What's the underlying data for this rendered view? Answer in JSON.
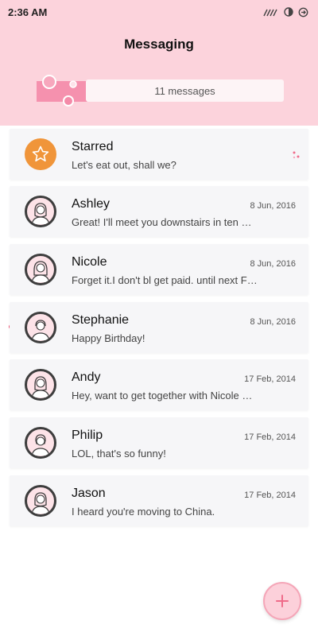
{
  "status_bar": {
    "time": "2:36 AM"
  },
  "header": {
    "title": "Messaging",
    "message_count": "11 messages"
  },
  "colors": {
    "header_bg": "#fcd3dc",
    "accent": "#f0953a",
    "unread": "#ef4d6e"
  },
  "conversations": [
    {
      "name": "Starred",
      "preview": "Let's eat out, shall we?",
      "date": "",
      "icon": "star-icon"
    },
    {
      "name": "Ashley",
      "preview": "Great! I'll meet you downstairs in ten …",
      "date": "8 Jun, 2016",
      "icon": "person-avatar"
    },
    {
      "name": "Nicole",
      "preview": "Forget it.I don't bl get paid. until next F…",
      "date": "8 Jun, 2016",
      "icon": "person-avatar"
    },
    {
      "name": "Stephanie",
      "preview": "Happy Birthday!",
      "date": "8 Jun, 2016",
      "icon": "person-avatar",
      "unread": true
    },
    {
      "name": "Andy",
      "preview": "Hey, want to get together with Nicole …",
      "date": "17 Feb, 2014",
      "icon": "person-avatar"
    },
    {
      "name": "Philip",
      "preview": "LOL, that's so funny!",
      "date": "17 Feb, 2014",
      "icon": "person-avatar"
    },
    {
      "name": "Jason",
      "preview": "I heard you're moving to China.",
      "date": "17 Feb, 2014",
      "icon": "person-avatar"
    }
  ],
  "fab": {
    "icon": "plus-icon"
  }
}
